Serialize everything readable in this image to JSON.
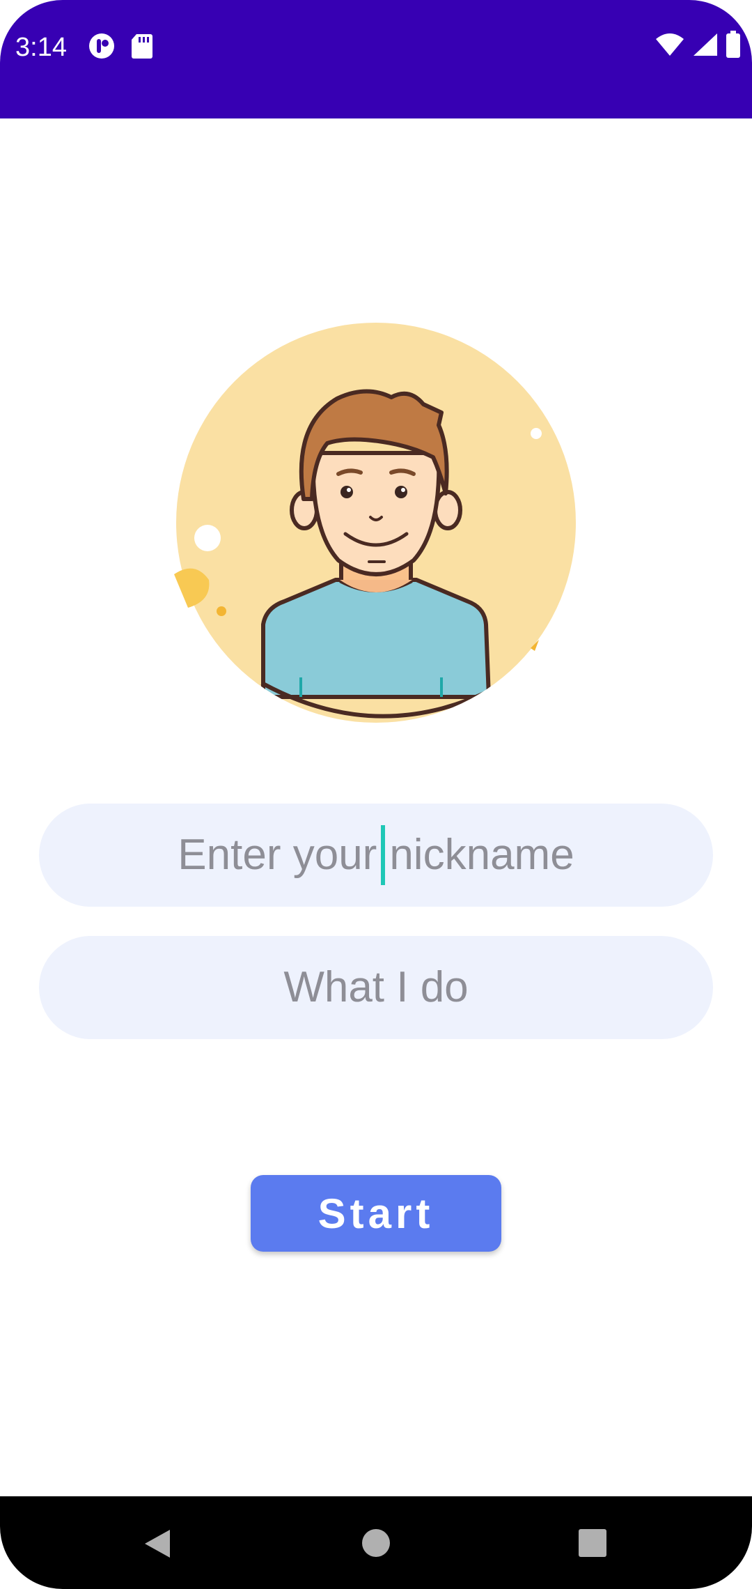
{
  "status_bar": {
    "time": "3:14",
    "background": "#3700b3",
    "left_icons": [
      "app-notification-icon",
      "sd-card-icon"
    ],
    "right_icons": [
      "wifi-icon",
      "cell-signal-icon",
      "battery-icon"
    ]
  },
  "avatar": {
    "icon": "avatar-illustration-icon",
    "background": "#fae0a3",
    "shirt_color": "#8acbd8",
    "hair_color": "#bf7a44"
  },
  "form": {
    "nickname": {
      "value_before_cursor": "Enter your",
      "value_after_cursor": "nickname",
      "placeholder": "Enter your nickname"
    },
    "job": {
      "placeholder": "What I do"
    },
    "field_background": "#eef2fd"
  },
  "start_button": {
    "label": "Start",
    "color": "#5b7bef"
  },
  "nav_bar": {
    "buttons": [
      "back-icon",
      "home-icon",
      "recents-icon"
    ]
  }
}
